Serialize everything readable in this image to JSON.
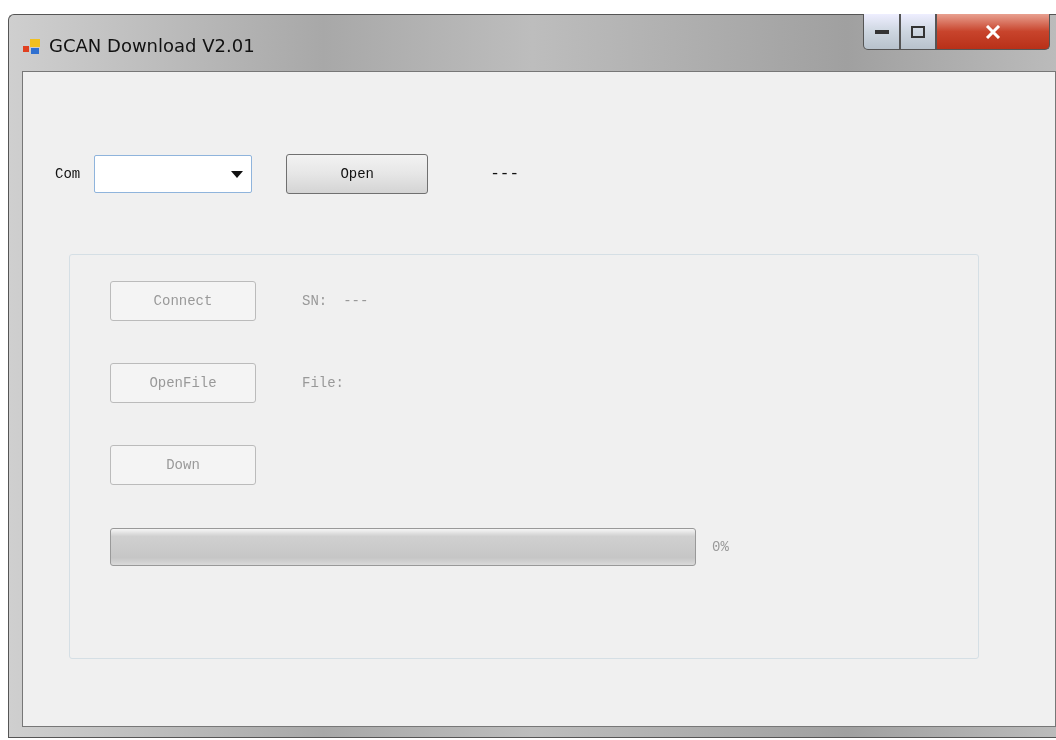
{
  "window": {
    "title": "GCAN Download V2.01"
  },
  "port": {
    "label": "Com",
    "button": "Open",
    "disabled": false,
    "status": "---"
  },
  "device": {
    "actions": [
      {
        "button": "Connect",
        "disabled": true,
        "label": "SN:",
        "value": "---"
      },
      {
        "button": "OpenFile",
        "disabled": true,
        "label": "File:"
      },
      {
        "button": "Down",
        "disabled": true
      }
    ],
    "progress": {
      "level": 0,
      "reading": "0%",
      "disabled": true
    }
  }
}
